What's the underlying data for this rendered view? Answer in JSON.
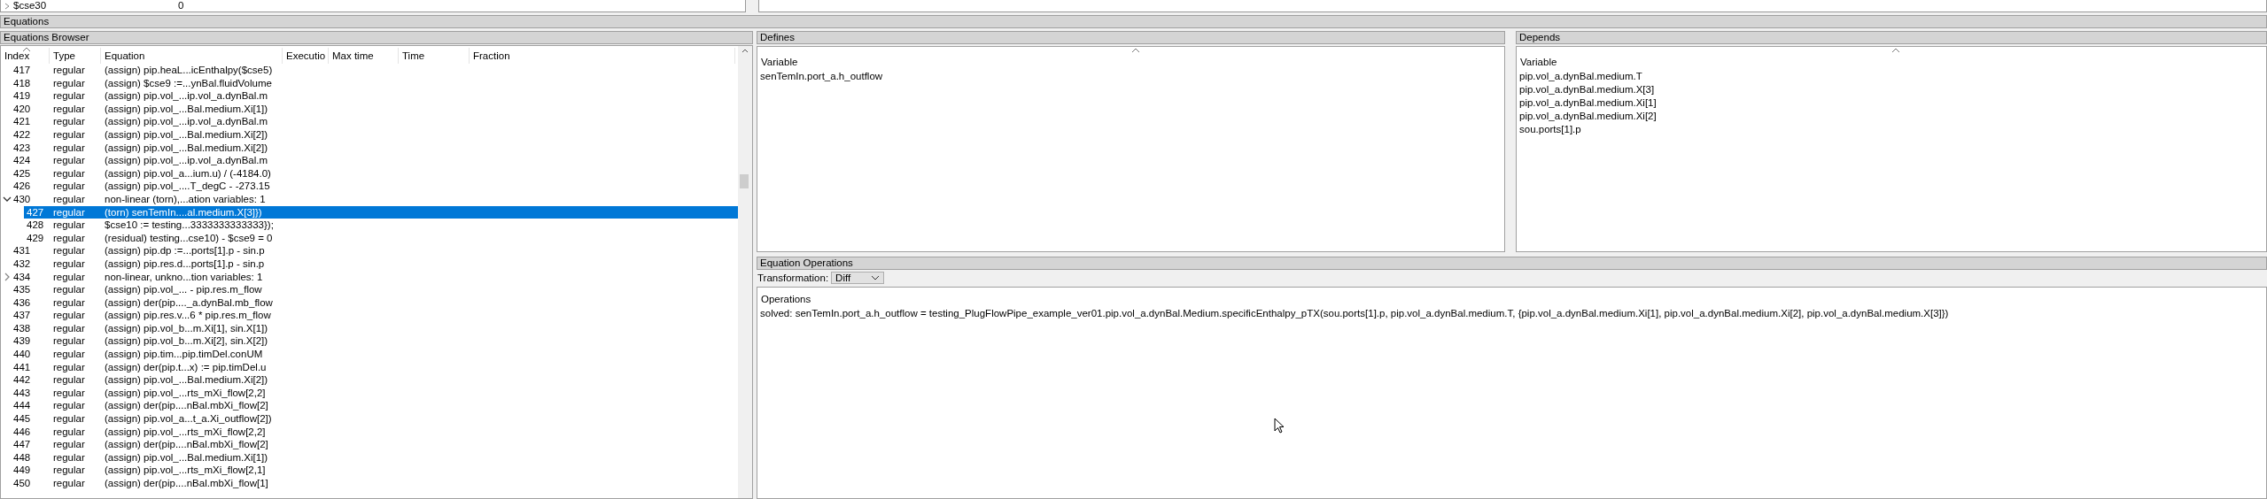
{
  "top_row": {
    "name": "$cse30",
    "value": "0"
  },
  "section_title": "Equations",
  "browser": {
    "title": "Equations Browser",
    "columns": [
      "Index",
      "Type",
      "Equation",
      "Executio",
      "Max time",
      "Time",
      "Fraction"
    ],
    "rows": [
      {
        "index": "417",
        "type": "regular",
        "equation": "(assign) pip.heaL...icEnthalpy($cse5)",
        "selected": false
      },
      {
        "index": "418",
        "type": "regular",
        "equation": "(assign) $cse9 :=...ynBal.fluidVolume",
        "selected": false
      },
      {
        "index": "419",
        "type": "regular",
        "equation": "(assign) pip.vol_...ip.vol_a.dynBal.m",
        "selected": false
      },
      {
        "index": "420",
        "type": "regular",
        "equation": "(assign) pip.vol_...Bal.medium.Xi[1])",
        "selected": false
      },
      {
        "index": "421",
        "type": "regular",
        "equation": "(assign) pip.vol_...ip.vol_a.dynBal.m",
        "selected": false
      },
      {
        "index": "422",
        "type": "regular",
        "equation": "(assign) pip.vol_...Bal.medium.Xi[2])",
        "selected": false
      },
      {
        "index": "423",
        "type": "regular",
        "equation": "(assign) pip.vol_...Bal.medium.Xi[2])",
        "selected": false
      },
      {
        "index": "424",
        "type": "regular",
        "equation": "(assign) pip.vol_...ip.vol_a.dynBal.m",
        "selected": false
      },
      {
        "index": "425",
        "type": "regular",
        "equation": "(assign) pip.vol_a...ium.u) / (-4184.0)",
        "selected": false
      },
      {
        "index": "426",
        "type": "regular",
        "equation": "(assign) pip.vol_....T_degC - -273.15",
        "selected": false
      },
      {
        "index": "430",
        "type": "regular",
        "equation": "non-linear (torn),...ation variables: 1",
        "selected": false,
        "expanded": true,
        "children": [
          {
            "index": "427",
            "type": "regular",
            "equation": "(torn) senTemIn....al.medium.X[3]})",
            "selected": true
          },
          {
            "index": "428",
            "type": "regular",
            "equation": "$cse10 := testing...3333333333333});",
            "selected": false
          },
          {
            "index": "429",
            "type": "regular",
            "equation": "(residual) testing...cse10) - $cse9 = 0",
            "selected": false
          }
        ]
      },
      {
        "index": "431",
        "type": "regular",
        "equation": "(assign) pip.dp :=...ports[1].p - sin.p",
        "selected": false
      },
      {
        "index": "432",
        "type": "regular",
        "equation": "(assign) pip.res.d...ports[1].p - sin.p",
        "selected": false
      },
      {
        "index": "434",
        "type": "regular",
        "equation": "non-linear, unkno...tion variables: 1",
        "selected": false,
        "expanded": false
      },
      {
        "index": "435",
        "type": "regular",
        "equation": "(assign) pip.vol_... - pip.res.m_flow",
        "selected": false
      },
      {
        "index": "436",
        "type": "regular",
        "equation": "(assign) der(pip...._a.dynBal.mb_flow",
        "selected": false
      },
      {
        "index": "437",
        "type": "regular",
        "equation": "(assign) pip.res.v...6 * pip.res.m_flow",
        "selected": false
      },
      {
        "index": "438",
        "type": "regular",
        "equation": "(assign) pip.vol_b...m.Xi[1], sin.X[1])",
        "selected": false
      },
      {
        "index": "439",
        "type": "regular",
        "equation": "(assign) pip.vol_b...m.Xi[2], sin.X[2])",
        "selected": false
      },
      {
        "index": "440",
        "type": "regular",
        "equation": "(assign) pip.tim...pip.timDel.conUM",
        "selected": false
      },
      {
        "index": "441",
        "type": "regular",
        "equation": "(assign) der(pip.t...x) := pip.timDel.u",
        "selected": false
      },
      {
        "index": "442",
        "type": "regular",
        "equation": "(assign) pip.vol_...Bal.medium.Xi[2])",
        "selected": false
      },
      {
        "index": "443",
        "type": "regular",
        "equation": "(assign) pip.vol_...rts_mXi_flow[2,2]",
        "selected": false
      },
      {
        "index": "444",
        "type": "regular",
        "equation": "(assign) der(pip....nBal.mbXi_flow[2]",
        "selected": false
      },
      {
        "index": "445",
        "type": "regular",
        "equation": "(assign) pip.vol_a...t_a.Xi_outflow[2])",
        "selected": false
      },
      {
        "index": "446",
        "type": "regular",
        "equation": "(assign) pip.vol_...rts_mXi_flow[2,2]",
        "selected": false
      },
      {
        "index": "447",
        "type": "regular",
        "equation": "(assign) der(pip....nBal.mbXi_flow[2]",
        "selected": false
      },
      {
        "index": "448",
        "type": "regular",
        "equation": "(assign) pip.vol_...Bal.medium.Xi[1])",
        "selected": false
      },
      {
        "index": "449",
        "type": "regular",
        "equation": "(assign) pip.vol_...rts_mXi_flow[2,1]",
        "selected": false
      },
      {
        "index": "450",
        "type": "regular",
        "equation": "(assign) der(pip....nBal.mbXi_flow[1]",
        "selected": false
      }
    ]
  },
  "defines": {
    "title": "Defines",
    "column": "Variable",
    "items": [
      "senTemIn.port_a.h_outflow"
    ]
  },
  "depends": {
    "title": "Depends",
    "column": "Variable",
    "items": [
      "pip.vol_a.dynBal.medium.T",
      "pip.vol_a.dynBal.medium.X[3]",
      "pip.vol_a.dynBal.medium.Xi[1]",
      "pip.vol_a.dynBal.medium.Xi[2]",
      "sou.ports[1].p"
    ]
  },
  "operations": {
    "title": "Equation Operations",
    "transformation_label": "Transformation:",
    "transformation_value": "Diff",
    "column": "Operations",
    "items": [
      "solved: senTemIn.port_a.h_outflow = testing_PlugFlowPipe_example_ver01.pip.vol_a.dynBal.Medium.specificEnthalpy_pTX(sou.ports[1].p, pip.vol_a.dynBal.medium.T, {pip.vol_a.dynBal.medium.Xi[1], pip.vol_a.dynBal.medium.Xi[2], pip.vol_a.dynBal.medium.X[3]})"
    ]
  }
}
